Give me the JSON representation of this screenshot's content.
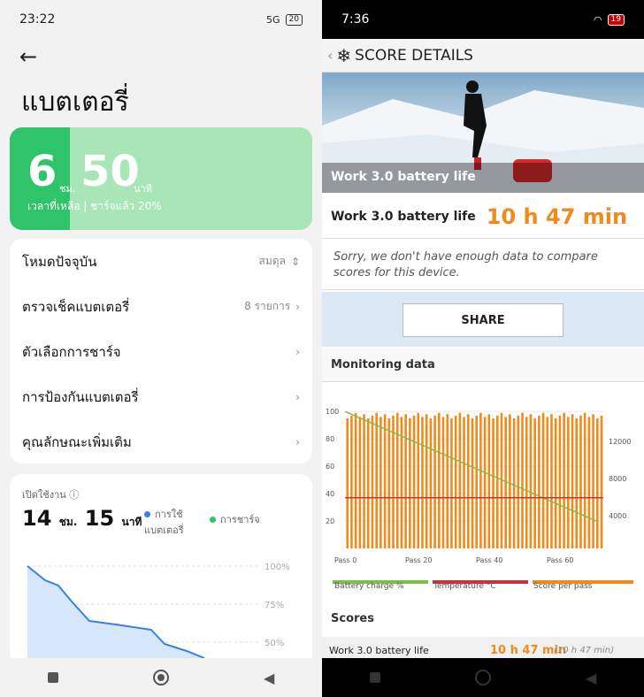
{
  "left": {
    "status": {
      "time": "23:22",
      "battery": "20",
      "signal": "5G"
    },
    "title": "แบตเตอรี่",
    "remaining": {
      "hours": "6",
      "hours_unit": "ชม.",
      "minutes": "50",
      "minutes_unit": "นาที",
      "subtitle": "เวลาที่เหลือ | ชาร์จแล้ว 20%",
      "level_fraction": 0.2
    },
    "menu": [
      {
        "label": "โหมดปัจจุบัน",
        "value": "สมดุล"
      },
      {
        "label": "ตรวจเช็คแบตเตอรี่",
        "value": "8 รายการ"
      },
      {
        "label": "ตัวเลือกการชาร์จ",
        "value": ""
      },
      {
        "label": "การป้องกันแบตเตอรี่",
        "value": ""
      },
      {
        "label": "คุณลักษณะเพิ่มเติม",
        "value": ""
      }
    ],
    "usage": {
      "label": "เปิดใช้งาน",
      "hours": "14",
      "hours_unit": "ชม.",
      "minutes": "15",
      "minutes_unit": "นาที",
      "legend_use": "การใช้ แบตเตอรี่",
      "legend_charge": "การชาร์จ",
      "ticks": [
        "100%",
        "75%",
        "50%"
      ]
    }
  },
  "right": {
    "status": {
      "time": "7:36",
      "battery": "19"
    },
    "header": "SCORE DETAILS",
    "hero_label": "Work 3.0 battery life",
    "battery_label": "Work 3.0 battery life",
    "battery_value": "10 h 47 min",
    "sorry": "Sorry, we don't have enough data to compare scores for this device.",
    "share": "SHARE",
    "monitoring": "Monitoring data",
    "legend": [
      "Battery charge %",
      "Temperature °C",
      "Score per pass"
    ],
    "scores_title": "Scores",
    "score_row": {
      "label": "Work 3.0 battery life",
      "value": "10 h 47 min",
      "sub": "(10 h 47 min)"
    }
  },
  "chart_data": {
    "type": "bar",
    "title": "",
    "x_ticks": [
      "Pass 0",
      "Pass 20",
      "Pass 40",
      "Pass 60"
    ],
    "y_left_ticks": [
      100,
      80,
      60,
      40,
      20
    ],
    "y_right_ticks": [
      12000,
      8000,
      4000
    ],
    "series": [
      {
        "name": "Score per pass",
        "type": "bar",
        "approx_value": 97
      },
      {
        "name": "Battery charge %",
        "type": "line",
        "start": 100,
        "end": 20
      },
      {
        "name": "Temperature °C",
        "type": "line",
        "approx": 37
      }
    ]
  }
}
